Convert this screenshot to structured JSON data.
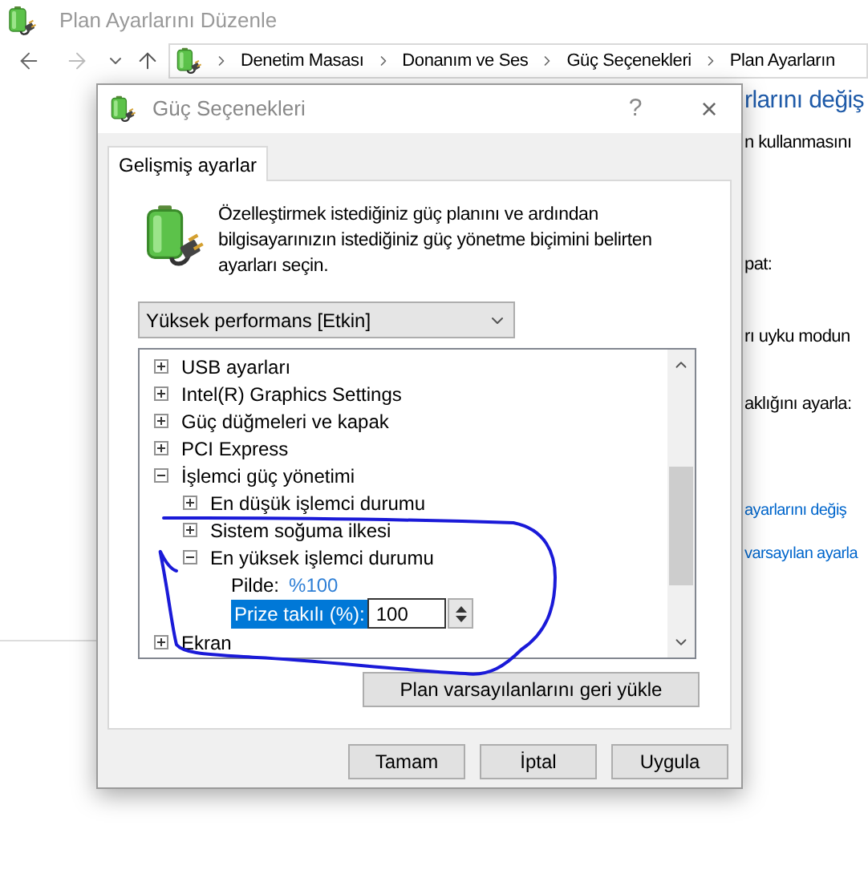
{
  "background_window": {
    "title": "Plan Ayarlarını Düzenle",
    "breadcrumb": [
      "Denetim Masası",
      "Donanım ve Ses",
      "Güç Seçenekleri",
      "Plan Ayarların"
    ],
    "partial_texts": [
      {
        "text": "rlarını değiş",
        "kind": "heading"
      },
      {
        "text": "n kullanmasını",
        "kind": "text"
      },
      {
        "text": "pat:",
        "kind": "text"
      },
      {
        "text": "rı uyku modun",
        "kind": "text"
      },
      {
        "text": "aklığını ayarla:",
        "kind": "text"
      },
      {
        "text": "ayarlarını değiş",
        "kind": "link"
      },
      {
        "text": "varsayılan ayarla",
        "kind": "link"
      }
    ]
  },
  "dialog": {
    "title": "Güç Seçenekleri",
    "help_button": "?",
    "close_button": "×",
    "tabs": [
      {
        "label": "Gelişmiş ayarlar",
        "selected": true
      }
    ],
    "description": "Özelleştirmek istediğiniz güç planını ve ardından bilgisayarınızın istediğiniz güç yönetme biçimini belirten ayarları seçin.",
    "plan_select": {
      "value": "Yüksek performans [Etkin]"
    },
    "settings_tree": [
      {
        "kind": "group",
        "label": "USB ayarları",
        "expanded": false
      },
      {
        "kind": "group",
        "label": "Intel(R) Graphics Settings",
        "expanded": false
      },
      {
        "kind": "group",
        "label": "Güç düğmeleri ve kapak",
        "expanded": false
      },
      {
        "kind": "group",
        "label": "PCI Express",
        "expanded": false
      },
      {
        "kind": "group",
        "label": "İşlemci güç yönetimi",
        "expanded": true,
        "children": [
          {
            "kind": "group",
            "label": "En düşük işlemci durumu",
            "expanded": false
          },
          {
            "kind": "group",
            "label": "Sistem soğuma ilkesi",
            "expanded": false
          },
          {
            "kind": "group",
            "label": "En yüksek işlemci durumu",
            "expanded": true,
            "children": [
              {
                "kind": "value",
                "label": "Pilde:",
                "value": "%100"
              },
              {
                "kind": "spin",
                "label": "Prize takılı (%):",
                "value": "100",
                "selected": true
              }
            ]
          }
        ]
      },
      {
        "kind": "group",
        "label": "Ekran",
        "expanded": false
      }
    ],
    "restore_button": "Plan varsayılanlarını geri yükle",
    "buttons": [
      "Tamam",
      "İptal",
      "Uygula"
    ]
  }
}
